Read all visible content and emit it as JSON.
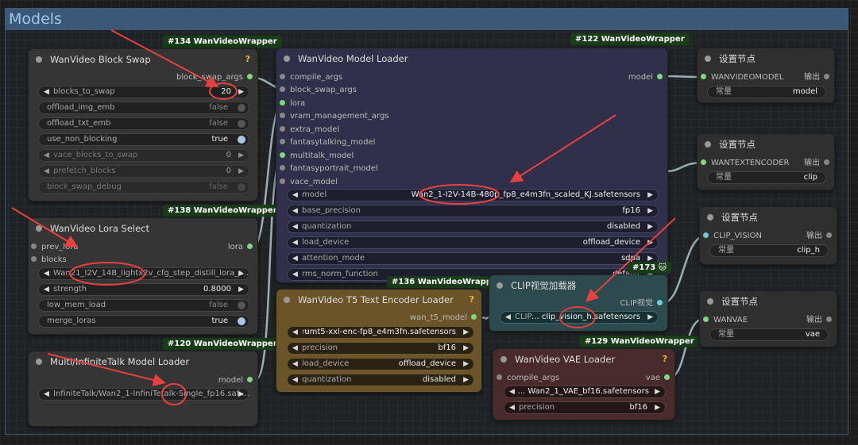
{
  "group": {
    "title": "Models"
  },
  "badges": {
    "b134": "#134 WanVideoWrapper",
    "b122": "#122 WanVideoWrapper",
    "b138": "#138 WanVideoWrapper",
    "b120": "#120 WanVideoWrapper",
    "b136": "#136 WanVideoWrapper",
    "b129": "#129 WanVideoWrapper",
    "b173": "#173 🐱"
  },
  "block_swap": {
    "title": "WanVideo Block Swap",
    "output": "block_swap_args",
    "widgets": [
      {
        "label": "blocks_to_swap",
        "value": "20"
      },
      {
        "label": "offload_img_emb",
        "value": "false"
      },
      {
        "label": "offload_txt_emb",
        "value": "false"
      },
      {
        "label": "use_non_blocking",
        "value": "true"
      },
      {
        "label": "vace_blocks_to_swap",
        "value": "0"
      },
      {
        "label": "prefetch_blocks",
        "value": "0"
      },
      {
        "label": "block_swap_debug",
        "value": "false"
      }
    ]
  },
  "lora_select": {
    "title": "WanVideo Lora Select",
    "inputs": [
      "prev_lora",
      "blocks"
    ],
    "output": "lora",
    "lora_name": "Wan21_I2V_14B_lightx2v_cfg_step_distill_lora_r...",
    "strength_label": "strength",
    "strength_value": "0.8000",
    "low_mem_label": "low_mem_load",
    "low_mem_value": "false",
    "merge_label": "merge_loras",
    "merge_value": "true"
  },
  "infinitetalk": {
    "title": "Multi/InfiniteTalk Model Loader",
    "output": "model",
    "model": "InfiniteTalk/Wan2_1-InfiniTetalk-Single_fp16.saf ..."
  },
  "model_loader": {
    "title": "WanVideo Model Loader",
    "inputs": [
      "compile_args",
      "block_swap_args",
      "lora",
      "vram_management_args",
      "extra_model",
      "fantasytalking_model",
      "multitalk_model",
      "fantasyportrait_model",
      "vace_model"
    ],
    "output": "model",
    "widgets": [
      {
        "label": "model",
        "value": "Wan2_1-I2V-14B-480p_fp8_e4m3fn_scaled_KJ.safetensors"
      },
      {
        "label": "base_precision",
        "value": "fp16"
      },
      {
        "label": "quantization",
        "value": "disabled"
      },
      {
        "label": "load_device",
        "value": "offload_device"
      },
      {
        "label": "attention_mode",
        "value": "sdpa"
      },
      {
        "label": "rms_norm_function",
        "value": "default"
      }
    ]
  },
  "t5_loader": {
    "title": "WanVideo T5 Text Encoder Loader",
    "output": "wan_t5_model",
    "widgets": [
      {
        "label": "m ...",
        "value": "umt5-xxl-enc-fp8_e4m3fn.safetensors"
      },
      {
        "label": "precision",
        "value": "bf16"
      },
      {
        "label": "load_device",
        "value": "offload_device"
      },
      {
        "label": "quantization",
        "value": "disabled"
      }
    ]
  },
  "clip_loader": {
    "title": "CLIP视觉加载器",
    "output": "CLIP视觉",
    "widget_label": "CLIP",
    "widget_value": "... clip_vision_h.safetensors"
  },
  "vae_loader": {
    "title": "WanVideo VAE Loader",
    "input": "compile_args",
    "output": "vae",
    "model": "... Wan2_1_VAE_bf16.safetensors",
    "precision_label": "precision",
    "precision_value": "bf16"
  },
  "set_nodes": [
    {
      "title": "设置节点",
      "input": "WANVIDEOMODEL",
      "output": "输出",
      "const_label": "常量",
      "const_value": "model"
    },
    {
      "title": "设置节点",
      "input": "WANTEXTENCODER",
      "output": "输出",
      "const_label": "常量",
      "const_value": "clip"
    },
    {
      "title": "设置节点",
      "input": "CLIP_VISION",
      "output": "输出",
      "const_label": "常量",
      "const_value": "clip_h"
    },
    {
      "title": "设置节点",
      "input": "WANVAE",
      "output": "输出",
      "const_label": "常量",
      "const_value": "vae"
    }
  ],
  "colors": {
    "group_header": "#3b5876",
    "link": "#9ab0b0",
    "annotation": "#e64040",
    "badge": "#183d18"
  }
}
